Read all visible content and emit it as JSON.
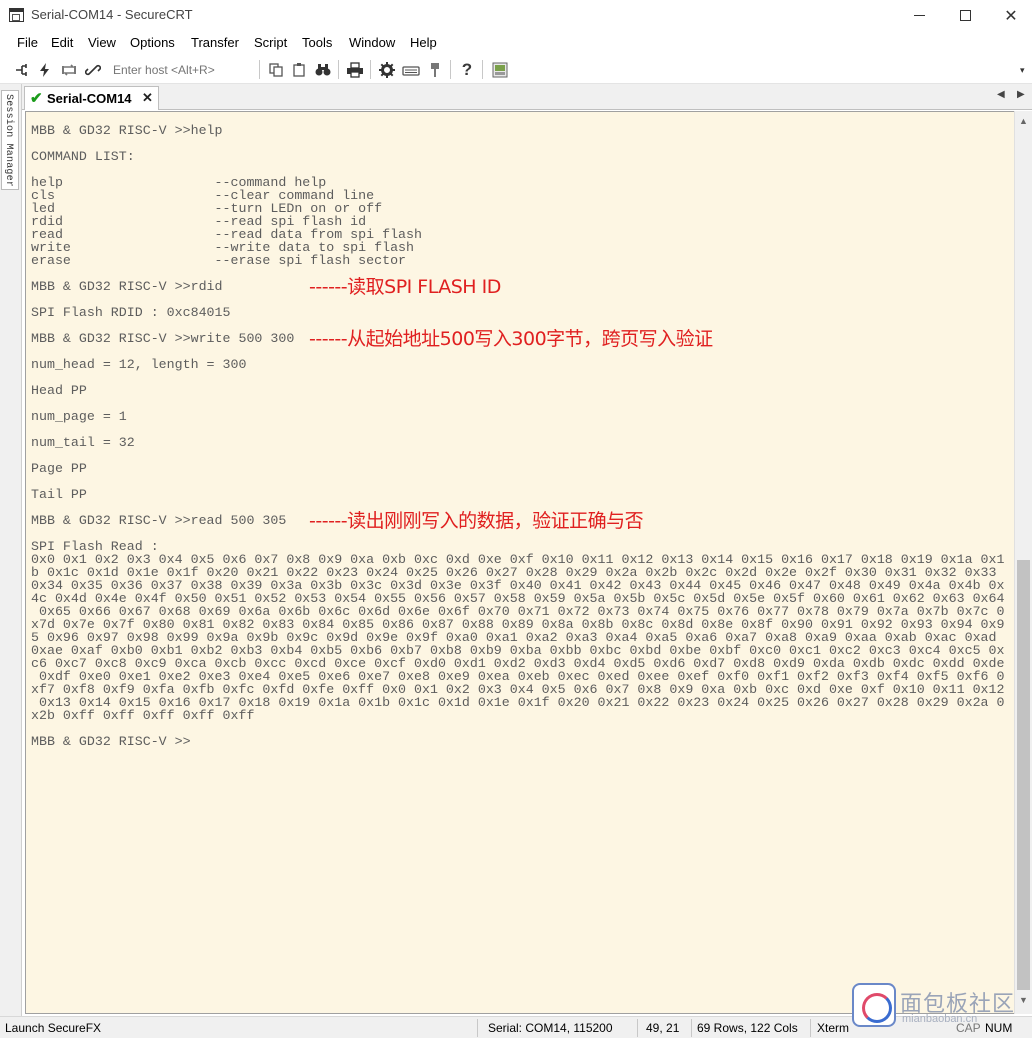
{
  "window": {
    "title": "Serial-COM14 - SecureCRT",
    "minimize": "—",
    "close": "✕"
  },
  "menu": {
    "items": [
      "File",
      "Edit",
      "View",
      "Options",
      "Transfer",
      "Script",
      "Tools",
      "Window",
      "Help"
    ]
  },
  "toolbar": {
    "host_placeholder": "Enter host <Alt+R>",
    "icons": [
      "connect-icon",
      "quick-connect-icon",
      "reconnect-icon",
      "disconnect-icon",
      "copy-icon",
      "paste-icon",
      "find-icon",
      "print-icon",
      "session-options-icon",
      "keymap-icon",
      "sftp-icon",
      "help-icon",
      "screen-icon"
    ],
    "overflow": "▾"
  },
  "tabs": {
    "active": {
      "label": "Serial-COM14",
      "check": "✔",
      "close": "✕"
    },
    "scroll_left": "◀",
    "scroll_right": "▶"
  },
  "session_manager": {
    "label": "Session Manager"
  },
  "terminal": {
    "lines": [
      "MBB & GD32 RISC-V >>help",
      "",
      "COMMAND LIST:",
      "",
      "help                   --command help",
      "cls                    --clear command line",
      "led                    --turn LEDn on or off",
      "rdid                   --read spi flash id",
      "read                   --read data from spi flash",
      "write                  --write data to spi flash",
      "erase                  --erase spi flash sector",
      "",
      "MBB & GD32 RISC-V >>rdid",
      "",
      "SPI Flash RDID : 0xc84015",
      "",
      "MBB & GD32 RISC-V >>write 500 300",
      "",
      "num_head = 12, length = 300",
      "",
      "Head PP",
      "",
      "num_page = 1",
      "",
      "num_tail = 32",
      "",
      "Page PP",
      "",
      "Tail PP",
      "",
      "MBB & GD32 RISC-V >>read 500 305",
      "",
      "SPI Flash Read :",
      "0x0 0x1 0x2 0x3 0x4 0x5 0x6 0x7 0x8 0x9 0xa 0xb 0xc 0xd 0xe 0xf 0x10 0x11 0x12 0x13 0x14 0x15 0x16 0x17 0x18 0x19 0x1a 0x1",
      "b 0x1c 0x1d 0x1e 0x1f 0x20 0x21 0x22 0x23 0x24 0x25 0x26 0x27 0x28 0x29 0x2a 0x2b 0x2c 0x2d 0x2e 0x2f 0x30 0x31 0x32 0x33",
      "0x34 0x35 0x36 0x37 0x38 0x39 0x3a 0x3b 0x3c 0x3d 0x3e 0x3f 0x40 0x41 0x42 0x43 0x44 0x45 0x46 0x47 0x48 0x49 0x4a 0x4b 0x",
      "4c 0x4d 0x4e 0x4f 0x50 0x51 0x52 0x53 0x54 0x55 0x56 0x57 0x58 0x59 0x5a 0x5b 0x5c 0x5d 0x5e 0x5f 0x60 0x61 0x62 0x63 0x64",
      " 0x65 0x66 0x67 0x68 0x69 0x6a 0x6b 0x6c 0x6d 0x6e 0x6f 0x70 0x71 0x72 0x73 0x74 0x75 0x76 0x77 0x78 0x79 0x7a 0x7b 0x7c 0",
      "x7d 0x7e 0x7f 0x80 0x81 0x82 0x83 0x84 0x85 0x86 0x87 0x88 0x89 0x8a 0x8b 0x8c 0x8d 0x8e 0x8f 0x90 0x91 0x92 0x93 0x94 0x9",
      "5 0x96 0x97 0x98 0x99 0x9a 0x9b 0x9c 0x9d 0x9e 0x9f 0xa0 0xa1 0xa2 0xa3 0xa4 0xa5 0xa6 0xa7 0xa8 0xa9 0xaa 0xab 0xac 0xad",
      "0xae 0xaf 0xb0 0xb1 0xb2 0xb3 0xb4 0xb5 0xb6 0xb7 0xb8 0xb9 0xba 0xbb 0xbc 0xbd 0xbe 0xbf 0xc0 0xc1 0xc2 0xc3 0xc4 0xc5 0x",
      "c6 0xc7 0xc8 0xc9 0xca 0xcb 0xcc 0xcd 0xce 0xcf 0xd0 0xd1 0xd2 0xd3 0xd4 0xd5 0xd6 0xd7 0xd8 0xd9 0xda 0xdb 0xdc 0xdd 0xde",
      " 0xdf 0xe0 0xe1 0xe2 0xe3 0xe4 0xe5 0xe6 0xe7 0xe8 0xe9 0xea 0xeb 0xec 0xed 0xee 0xef 0xf0 0xf1 0xf2 0xf3 0xf4 0xf5 0xf6 0",
      "xf7 0xf8 0xf9 0xfa 0xfb 0xfc 0xfd 0xfe 0xff 0x0 0x1 0x2 0x3 0x4 0x5 0x6 0x7 0x8 0x9 0xa 0xb 0xc 0xd 0xe 0xf 0x10 0x11 0x12",
      " 0x13 0x14 0x15 0x16 0x17 0x18 0x19 0x1a 0x1b 0x1c 0x1d 0x1e 0x1f 0x20 0x21 0x22 0x23 0x24 0x25 0x26 0x27 0x28 0x29 0x2a 0",
      "x2b 0xff 0xff 0xff 0xff 0xff",
      "",
      "MBB & GD32 RISC-V >>"
    ],
    "annotations": [
      {
        "line": 12,
        "text": "------读取SPI FLASH ID"
      },
      {
        "line": 16,
        "text": "------从起始地址500写入300字节，跨页写入验证"
      },
      {
        "line": 30,
        "text": "------读出刚刚写入的数据，验证正确与否"
      }
    ],
    "colors": {
      "background": "#fdf6e3",
      "text": "#5d5d5d",
      "annotation": "#e02020"
    }
  },
  "statusbar": {
    "launch": "Launch SecureFX",
    "connection": "Serial: COM14, 115200",
    "cursor": "49,  21",
    "size": "69 Rows, 122 Cols",
    "emulation": "Xterm",
    "cap": "CAP",
    "num": "NUM"
  },
  "watermark": {
    "title": "面包板社区",
    "subtitle": "mianbaoban.cn"
  }
}
